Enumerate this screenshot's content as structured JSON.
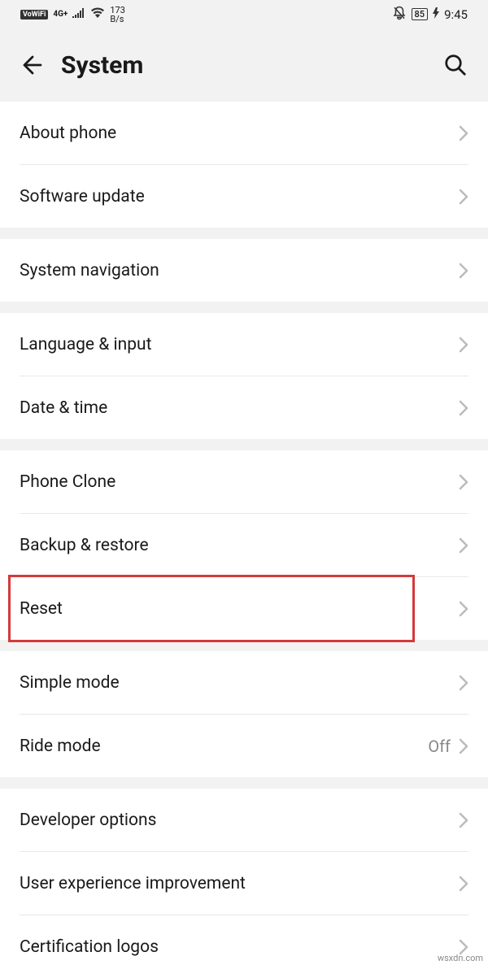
{
  "status": {
    "vowifi": "VoWiFi",
    "network": "4G+",
    "speed_num": "173",
    "speed_unit": "B/s",
    "battery": "85",
    "time": "9:45"
  },
  "header": {
    "title": "System"
  },
  "groups": [
    {
      "items": [
        {
          "id": "about-phone",
          "label": "About phone"
        },
        {
          "id": "software-update",
          "label": "Software update"
        }
      ]
    },
    {
      "items": [
        {
          "id": "system-navigation",
          "label": "System navigation"
        }
      ]
    },
    {
      "items": [
        {
          "id": "language-input",
          "label": "Language & input"
        },
        {
          "id": "date-time",
          "label": "Date & time"
        }
      ]
    },
    {
      "items": [
        {
          "id": "phone-clone",
          "label": "Phone Clone"
        },
        {
          "id": "backup-restore",
          "label": "Backup & restore"
        },
        {
          "id": "reset",
          "label": "Reset",
          "highlighted": true
        }
      ]
    },
    {
      "items": [
        {
          "id": "simple-mode",
          "label": "Simple mode"
        },
        {
          "id": "ride-mode",
          "label": "Ride mode",
          "value": "Off"
        }
      ]
    },
    {
      "items": [
        {
          "id": "developer-options",
          "label": "Developer options"
        },
        {
          "id": "user-experience",
          "label": "User experience improvement"
        },
        {
          "id": "certification-logos",
          "label": "Certification logos"
        }
      ]
    }
  ],
  "watermark": "wsxdn.com"
}
